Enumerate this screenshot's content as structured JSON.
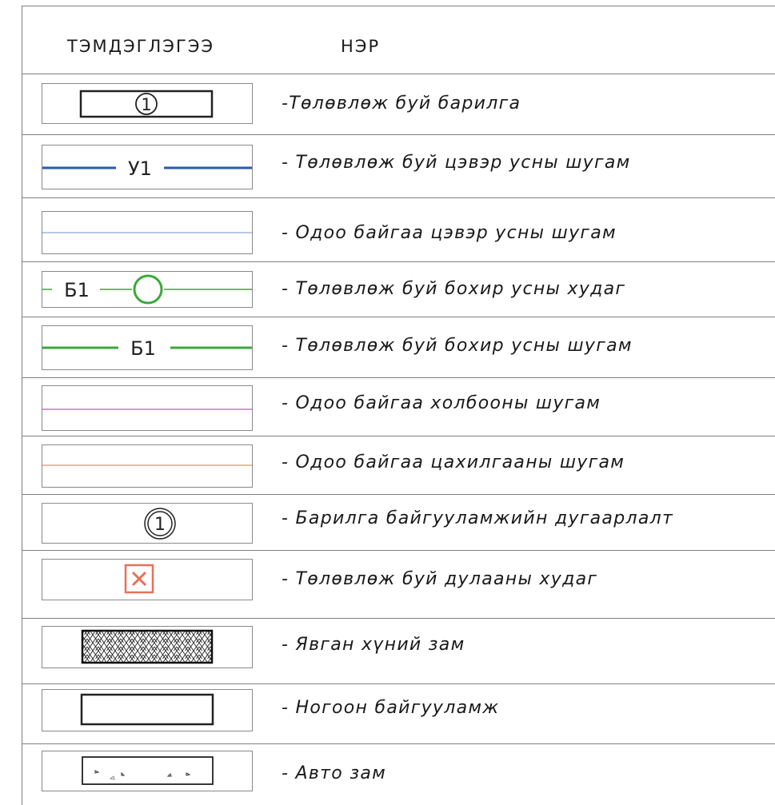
{
  "header": {
    "symbol_col": "ТЭМДЭГЛЭГЭЭ",
    "name_col": "НЭР"
  },
  "rows": [
    {
      "symbol": "building-circle",
      "label": "1",
      "name": "-Төлөвлөж буй барилга"
    },
    {
      "symbol": "line-labeled",
      "label": "У1",
      "color": "#2a5aa8",
      "name": "- Төлөвлөж буй цэвэр усны шугам"
    },
    {
      "symbol": "line-thin",
      "color": "#6d92c9",
      "name": "- Одоо байгаа цэвэр усны шугам"
    },
    {
      "symbol": "well-line",
      "label": "Б1",
      "color": "#3aa83a",
      "name": "- Төлөвлөж буй бохир усны худаг"
    },
    {
      "symbol": "line-labeled",
      "label": "Б1",
      "color": "#3aa83a",
      "name": "- Төлөвлөж буй бохир усны шугам"
    },
    {
      "symbol": "line-thin",
      "color": "#d070c8",
      "name": "- Одоо байгаа холбооны шугам"
    },
    {
      "symbol": "line-thin",
      "color": "#f0a070",
      "name": "- Одоо байгаа цахилгааны шугам"
    },
    {
      "symbol": "double-circle",
      "label": "1",
      "name": "- Барилга байгууламжийн дугаарлалт"
    },
    {
      "symbol": "x-box",
      "color": "#e8705a",
      "name": "- Төлөвлөж буй дулааны худаг"
    },
    {
      "symbol": "hatch-box",
      "name": "- Явган хүний зам"
    },
    {
      "symbol": "plain-box",
      "name": "- Ногоон байгууламж"
    },
    {
      "symbol": "road-box",
      "name": "- Авто зам"
    }
  ]
}
